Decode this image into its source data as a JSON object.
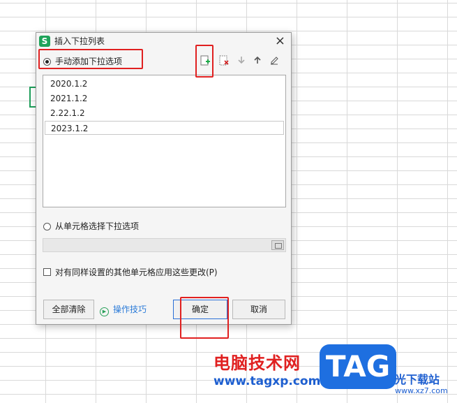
{
  "dialog": {
    "app_icon": "S",
    "title": "插入下拉列表",
    "close_glyph": "×",
    "manual_option_label": "手动添加下拉选项",
    "toolbar": {
      "add_icon": "add-item-icon",
      "delete_icon": "delete-item-icon",
      "move_down_icon": "move-down-icon",
      "move_up_icon": "move-up-icon",
      "edit_icon": "edit-item-icon"
    },
    "items": [
      "2020.1.2",
      "2021.1.2",
      "2.22.1.2",
      "2023.1.2"
    ],
    "cell_option_label": "从单元格选择下拉选项",
    "apply_checkbox_label": "对有同样设置的其他单元格应用这些更改(P)",
    "clear_all_label": "全部清除",
    "tips_label": "操作技巧",
    "ok_label": "确定",
    "cancel_label": "取消"
  },
  "watermark": {
    "site_name": "电脑技术网",
    "url": "www.tagxp.com",
    "tag": "TAG",
    "side_text": "光下载站",
    "side_url": "www.xz7.com"
  },
  "colors": {
    "highlight": "#e02020",
    "accent_green": "#1fa35a",
    "link_blue": "#2b7bd8",
    "primary_border": "#2a6fd6"
  }
}
